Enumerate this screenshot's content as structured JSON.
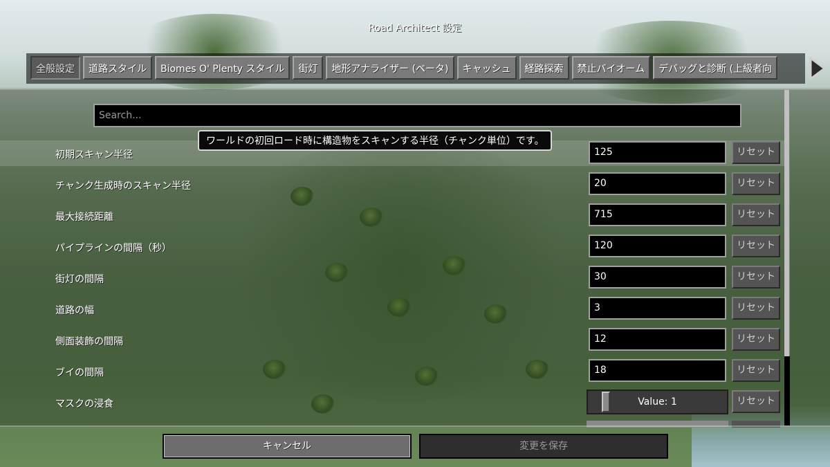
{
  "window": {
    "title": "Road Architect 設定"
  },
  "tabs": [
    {
      "label": "全般設定",
      "active": true
    },
    {
      "label": "道路スタイル",
      "active": false
    },
    {
      "label": "Biomes O' Plenty スタイル",
      "active": false
    },
    {
      "label": "街灯",
      "active": false
    },
    {
      "label": "地形アナライザー (ベータ)",
      "active": false
    },
    {
      "label": "キャッシュ",
      "active": false
    },
    {
      "label": "経路探索",
      "active": false
    },
    {
      "label": "禁止バイオーム",
      "active": false
    },
    {
      "label": "デバッグと診断 (上級者向",
      "active": false
    }
  ],
  "search": {
    "placeholder": "Search..."
  },
  "tooltip": {
    "text": "ワールドの初回ロード時に構造物をスキャンする半径（チャンク単位）です。"
  },
  "settings": [
    {
      "label": "初期スキャン半径",
      "value": "125",
      "reset": "リセット"
    },
    {
      "label": "チャンク生成時のスキャン半径",
      "value": "20",
      "reset": "リセット"
    },
    {
      "label": "最大接続距離",
      "value": "715",
      "reset": "リセット"
    },
    {
      "label": "パイプラインの間隔（秒）",
      "value": "120",
      "reset": "リセット"
    },
    {
      "label": "街灯の間隔",
      "value": "30",
      "reset": "リセット"
    },
    {
      "label": "道路の幅",
      "value": "3",
      "reset": "リセット"
    },
    {
      "label": "側面装飾の間隔",
      "value": "12",
      "reset": "リセット"
    },
    {
      "label": "ブイの間隔",
      "value": "18",
      "reset": "リセット"
    },
    {
      "label": "マスクの浸食",
      "value": "Value: 1",
      "reset": "リセット"
    }
  ],
  "footer": {
    "cancel": "キャンセル",
    "save": "変更を保存"
  },
  "colors": {
    "input_bg": "#000000",
    "button": "#545454",
    "tooltip_border": "#d8d8d8"
  }
}
